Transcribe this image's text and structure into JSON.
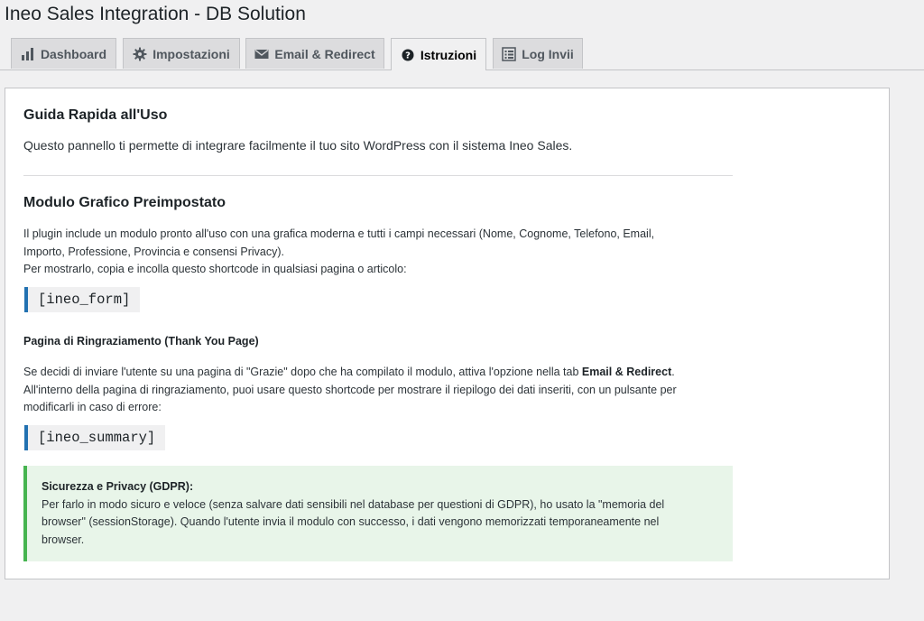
{
  "page": {
    "title": "Ineo Sales Integration - DB Solution"
  },
  "tabs": [
    {
      "label": "Dashboard",
      "icon": "bar-chart-icon"
    },
    {
      "label": "Impostazioni",
      "icon": "gear-icon"
    },
    {
      "label": "Email & Redirect",
      "icon": "envelope-icon"
    },
    {
      "label": "Istruzioni",
      "icon": "help-icon",
      "active": true
    },
    {
      "label": "Log Invii",
      "icon": "log-list-icon"
    }
  ],
  "guide": {
    "title": "Guida Rapida all'Uso",
    "intro": "Questo pannello ti permette di integrare facilmente il tuo sito WordPress con il sistema Ineo Sales."
  },
  "module": {
    "title": "Modulo Grafico Preimpostato",
    "line1": "Il plugin include un modulo pronto all'uso con una grafica moderna e tutti i campi necessari (Nome, Cognome, Telefono, Email,",
    "line2": "Importo, Professione, Provincia e consensi Privacy).",
    "line3": "Per mostrarlo, copia e incolla questo shortcode in qualsiasi pagina o articolo:",
    "shortcode": "[ineo_form]"
  },
  "thankyou": {
    "title": "Pagina di Ringraziamento (Thank You Page)",
    "line1_pre": "Se decidi di inviare l'utente su una pagina di \"Grazie\" dopo che ha compilato il modulo, attiva l'opzione nella tab ",
    "line1_bold": "Email & Redirect",
    "line1_post": ".",
    "line2": "All'interno della pagina di ringraziamento, puoi usare questo shortcode per mostrare il riepilogo dei dati inseriti, con un pulsante per",
    "line3": "modificarli in caso di errore:",
    "shortcode": "[ineo_summary]"
  },
  "privacy": {
    "title": "Sicurezza e Privacy (GDPR):",
    "line1": "Per farlo in modo sicuro e veloce (senza salvare dati sensibili nel database per questioni di GDPR), ho usato la \"memoria del",
    "line2": "browser\" (sessionStorage). Quando l'utente invia il modulo con successo, i dati vengono memorizzati temporaneamente nel",
    "line3": "browser.",
    "accent": "#46b450",
    "background": "#e8f5e9"
  },
  "colors": {
    "code_accent": "#2271b1",
    "panel_border": "#c3c4c7"
  }
}
